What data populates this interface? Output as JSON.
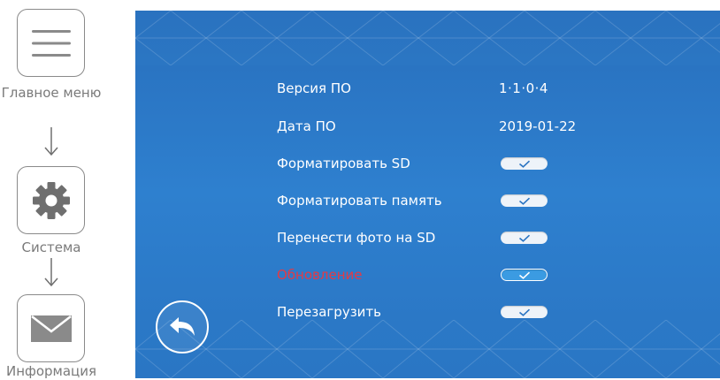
{
  "nav": {
    "items": [
      {
        "label": "Главное меню",
        "icon": "hamburger-menu-icon"
      },
      {
        "label": "Система",
        "icon": "gear-icon"
      },
      {
        "label": "Информация",
        "icon": "envelope-icon"
      }
    ]
  },
  "settings": {
    "rows": [
      {
        "label": "Версия ПО",
        "value": "1·1·0·4"
      },
      {
        "label": "Дата ПО",
        "value": "2019-01-22"
      },
      {
        "label": "Форматировать SD",
        "control": "toggle",
        "checked": true
      },
      {
        "label": "Форматировать память",
        "control": "toggle",
        "checked": true
      },
      {
        "label": "Перенести фото на SD",
        "control": "toggle",
        "checked": true
      },
      {
        "label": "Обновление",
        "control": "toggle",
        "checked": true,
        "selected": true
      },
      {
        "label": "Перезагрузить",
        "control": "toggle",
        "checked": true
      }
    ]
  },
  "back_button": {
    "icon": "back-arrow-icon"
  },
  "colors": {
    "screen_blue": "#2d7fcc",
    "selected_text": "#e33a45",
    "toggle_active": "#3b9be2",
    "toggle_idle": "#eef3f9",
    "check_mark": "#2a74c2"
  }
}
